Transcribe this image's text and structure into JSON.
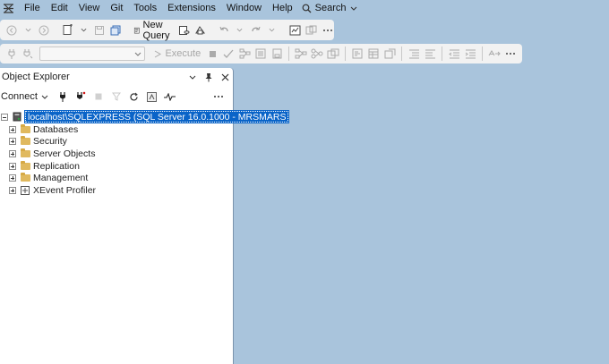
{
  "menubar": {
    "items": [
      "File",
      "Edit",
      "View",
      "Git",
      "Tools",
      "Extensions",
      "Window",
      "Help"
    ],
    "search_label": "Search"
  },
  "toolbar": {
    "new_query_label": "New Query",
    "execute_label": "Execute",
    "database_combo_value": ""
  },
  "object_explorer": {
    "title": "Object Explorer",
    "connect_label": "Connect",
    "root_label": "localhost\\SQLEXPRESS (SQL Server 16.0.1000 - MRSMARS",
    "children": [
      {
        "label": "Databases",
        "icon": "folder-icon"
      },
      {
        "label": "Security",
        "icon": "folder-icon"
      },
      {
        "label": "Server Objects",
        "icon": "folder-icon"
      },
      {
        "label": "Replication",
        "icon": "folder-icon"
      },
      {
        "label": "Management",
        "icon": "folder-icon"
      },
      {
        "label": "XEvent Profiler",
        "icon": "xevent-icon"
      }
    ]
  },
  "colors": {
    "background": "#a9c4dc",
    "selection": "#0a64c8",
    "folder": "#e0b95e"
  }
}
